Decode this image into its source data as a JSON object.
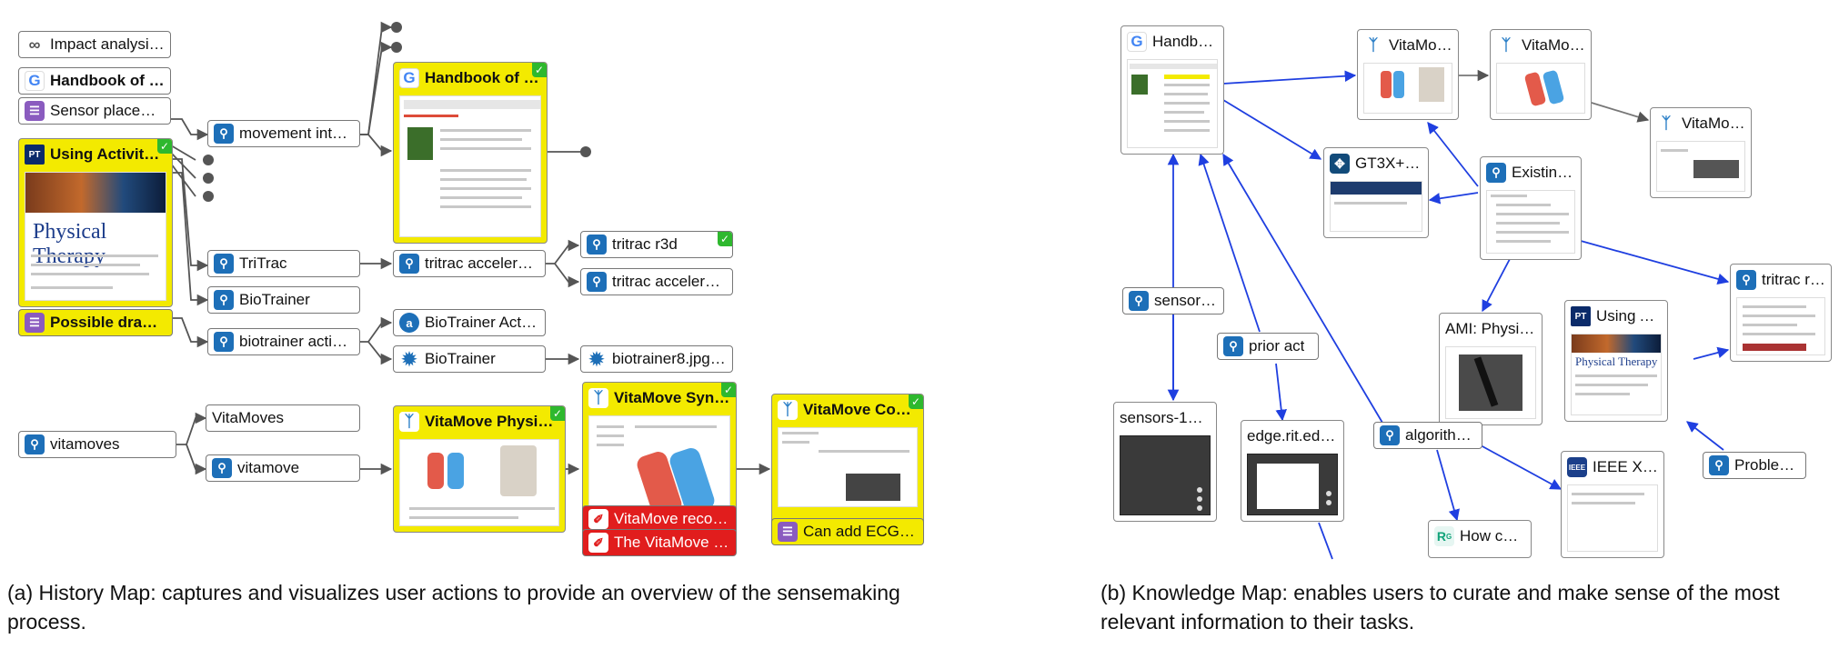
{
  "colors": {
    "search_icon": "#1d6fb8",
    "doc_icon": "#8a5bbf",
    "highlight": "#f3ea00",
    "error": "#e11d1d",
    "check": "#2eb82e",
    "km_link": "#1f3fe0"
  },
  "history_map": {
    "impact": {
      "label": "Impact analysis o...",
      "icon": "link-icon"
    },
    "handbook_small": {
      "label": "Handbook of Re...",
      "icon": "google-icon"
    },
    "sensor_placement": {
      "label": "Sensor placeme...",
      "icon": "note-icon"
    },
    "using_activity": {
      "label": "Using Activity M...",
      "icon": "pt-logo-icon"
    },
    "possible": {
      "label": "Possible drawba...",
      "icon": "note-icon"
    },
    "movement": {
      "label": "movement intens...",
      "icon": "search-icon"
    },
    "handbook_card": {
      "label": "Handbook of Re...",
      "icon": "google-icon"
    },
    "tritrac": {
      "label": "TriTrac",
      "icon": "search-icon"
    },
    "tritrac_acc": {
      "label": "tritrac accelerom...",
      "icon": "search-icon"
    },
    "tritrac_r3d": {
      "label": "tritrac r3d",
      "icon": "search-icon"
    },
    "tritrac_acc2": {
      "label": "tritrac accelerom...",
      "icon": "search-icon"
    },
    "biotrainer": {
      "label": "BioTrainer",
      "icon": "search-icon"
    },
    "biotrainer_act": {
      "label": "biotrainer activity...",
      "icon": "search-icon"
    },
    "biotrainer_a": {
      "label": "BioTrainer Activit...",
      "icon": "a-icon"
    },
    "biotrainer_gear": {
      "label": "BioTrainer",
      "icon": "gear-icon"
    },
    "biotrainer8": {
      "label": "biotrainer8.jpg (8...",
      "icon": "gear-icon"
    },
    "vitamoves": {
      "label": "vitamoves",
      "icon": "search-icon"
    },
    "vitamoves_link": {
      "label": "VitaMoves"
    },
    "vitamove": {
      "label": "vitamove",
      "icon": "search-icon"
    },
    "vm_physic": {
      "label": "VitaMove Physic...",
      "icon": "vitamove-icon"
    },
    "vm_synch": {
      "label": "VitaMove Synch...",
      "icon": "vitamove-icon"
    },
    "vm_record": {
      "label": "VitaMove record...",
      "icon": "brush-icon"
    },
    "vm_so": {
      "label": "The VitaMove so...",
      "icon": "brush-icon"
    },
    "vm_comb": {
      "label": "VitaMove Comb...",
      "icon": "vitamove-icon"
    },
    "ecg": {
      "label": "Can add ECG 3 ...",
      "icon": "note-icon"
    },
    "pt_banner_title": "Physical Therapy"
  },
  "knowledge_map": {
    "handbook": {
      "label": "Handboo...",
      "icon": "google-icon"
    },
    "vm1": {
      "label": "VitaMov...",
      "icon": "vitamove-icon"
    },
    "vm2": {
      "label": "VitaMov...",
      "icon": "vitamove-icon"
    },
    "vm3": {
      "label": "VitaMov...",
      "icon": "vitamove-icon"
    },
    "gt3x": {
      "label": "GT3X+ M...",
      "icon": "body-icon"
    },
    "existing": {
      "label": "Existing ...",
      "icon": "search-icon"
    },
    "tritrac": {
      "label": "tritrac r3d",
      "icon": "search-icon"
    },
    "sensor": {
      "label": "sensor p...",
      "icon": "search-icon"
    },
    "prior": {
      "label": "prior act",
      "icon": "search-icon"
    },
    "ami": {
      "label": "AMI: Physiol..."
    },
    "using": {
      "label": "Using Act...",
      "icon": "pt-logo-icon"
    },
    "sensors10": {
      "label": "sensors-10-0..."
    },
    "edge": {
      "label": "edge.rit.edu/..."
    },
    "algorithms": {
      "label": "algorithms",
      "icon": "search-icon"
    },
    "ieee": {
      "label": "IEEE Xpl...",
      "icon": "ieee-icon"
    },
    "problem": {
      "label": "Problem...",
      "icon": "search-icon"
    },
    "how": {
      "label": "How can...",
      "icon": "researchgate-icon"
    },
    "pt_banner_title": "Physical Therapy"
  },
  "captions": {
    "a": "(a) History Map: captures and visualizes user actions to provide an overview of the sensemaking process.",
    "b": "(b) Knowledge Map: enables users to curate and make sense of the most relevant information to their tasks."
  }
}
